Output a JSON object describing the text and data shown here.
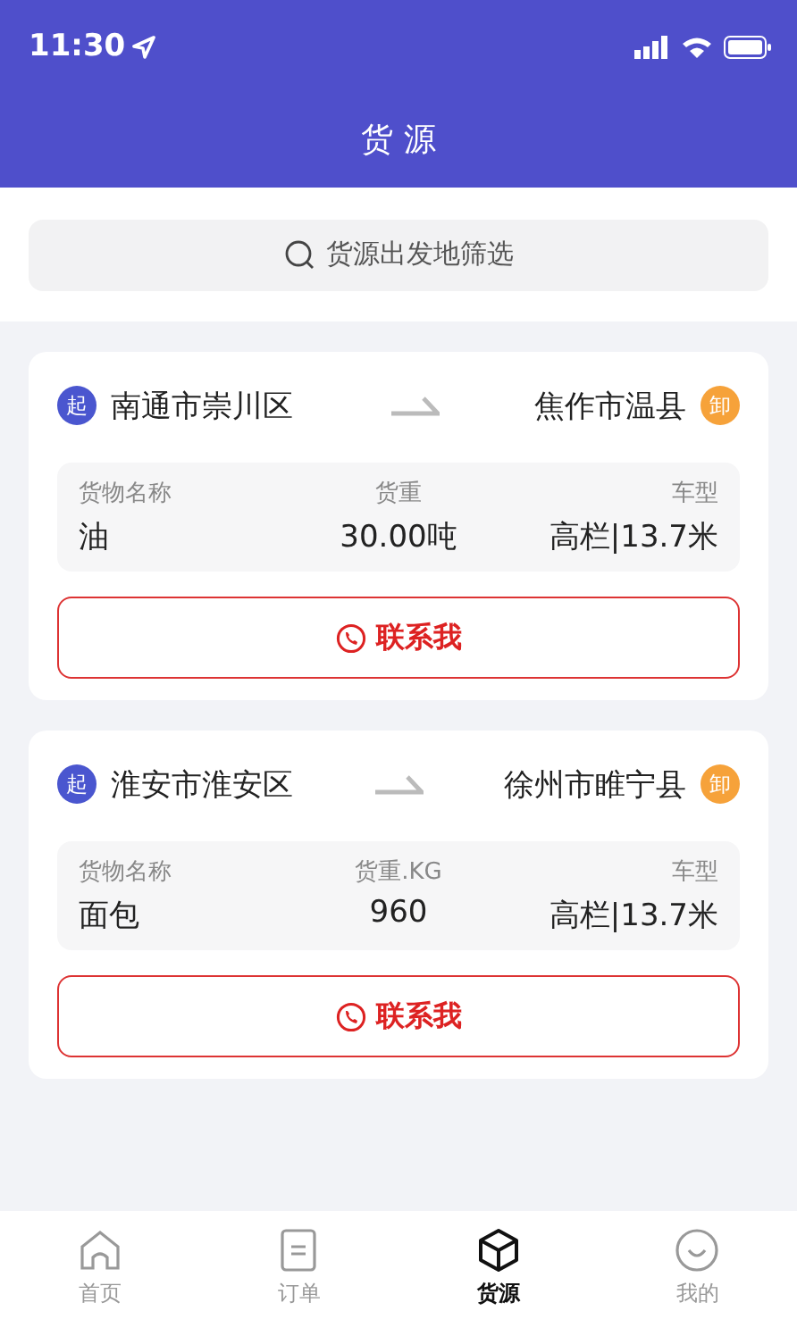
{
  "status_bar": {
    "time": "11:30"
  },
  "header": {
    "title": "货 源"
  },
  "search": {
    "placeholder": "货源出发地筛选"
  },
  "cards": [
    {
      "from_badge": "起",
      "from": "南通市崇川区",
      "to": "焦作市温县",
      "to_badge": "卸",
      "fields": [
        {
          "label": "货物名称",
          "value": "油"
        },
        {
          "label": "货重",
          "value": "30.00吨"
        },
        {
          "label": "车型",
          "value": "高栏|13.7米"
        }
      ],
      "button": "联系我"
    },
    {
      "from_badge": "起",
      "from": "淮安市淮安区",
      "to": "徐州市睢宁县",
      "to_badge": "卸",
      "fields": [
        {
          "label": "货物名称",
          "value": "面包"
        },
        {
          "label": "货重.KG",
          "value": "960"
        },
        {
          "label": "车型",
          "value": "高栏|13.7米"
        }
      ],
      "button": "联系我"
    }
  ],
  "tabs": [
    {
      "label": "首页",
      "kind": "home",
      "selected": false
    },
    {
      "label": "订单",
      "kind": "order",
      "selected": false
    },
    {
      "label": "货源",
      "kind": "box",
      "selected": true
    },
    {
      "label": "我的",
      "kind": "me",
      "selected": false
    }
  ]
}
